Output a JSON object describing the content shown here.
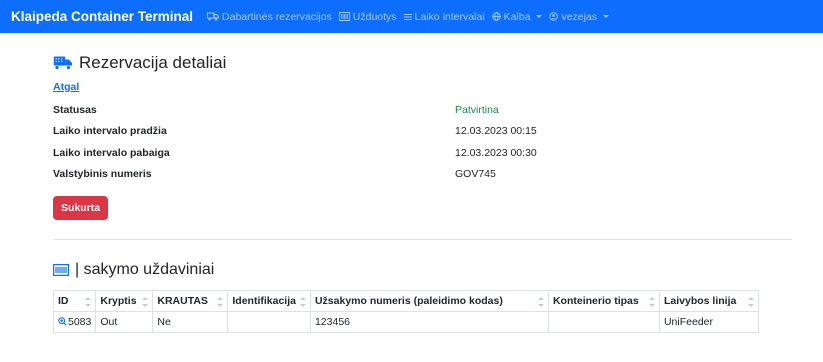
{
  "navbar": {
    "brand": "Klaipeda Container Terminal",
    "items": [
      {
        "label": "Dabartinės rezervacijos",
        "icon": "truck-icon"
      },
      {
        "label": "Užduotys",
        "icon": "barcode-icon"
      },
      {
        "label": "Laiko intervalai",
        "icon": "list-icon"
      },
      {
        "label": "Kalba",
        "icon": "globe-icon"
      },
      {
        "label": "vezejas",
        "icon": "user-circle-icon"
      }
    ]
  },
  "page": {
    "title": "Rezervacija detaliai",
    "back_link": "Atgal",
    "details": [
      {
        "label": "Statusas",
        "value": "Patvirtina"
      },
      {
        "label": "Laiko intervalo pradžia",
        "value": "12.03.2023 00:15"
      },
      {
        "label": "Laiko intervalo pabaiga",
        "value": "12.03.2023 00:30"
      },
      {
        "label": "Valstybinis numeris",
        "value": "GOV745"
      }
    ],
    "status_button": "Sukurta"
  },
  "tasks": {
    "title": "| sakymo uždaviniai",
    "columns": [
      "ID",
      "Kryptis",
      "KRAUTAS",
      "Identifikacija",
      "Užsakymo numeris (paleidimo kodas)",
      "Konteinerio tipas",
      "Laivybos linija"
    ],
    "rows": [
      {
        "id": "5083",
        "kryptis": "Out",
        "krautas": "Ne",
        "identifikacija": "",
        "uzsakymo_numeris": "123456",
        "konteinerio_tipas": "",
        "laivybos_linija": "UniFeeder"
      }
    ]
  },
  "colors": {
    "primary": "#0d6efd",
    "danger": "#dc3545",
    "success": "#198754"
  }
}
